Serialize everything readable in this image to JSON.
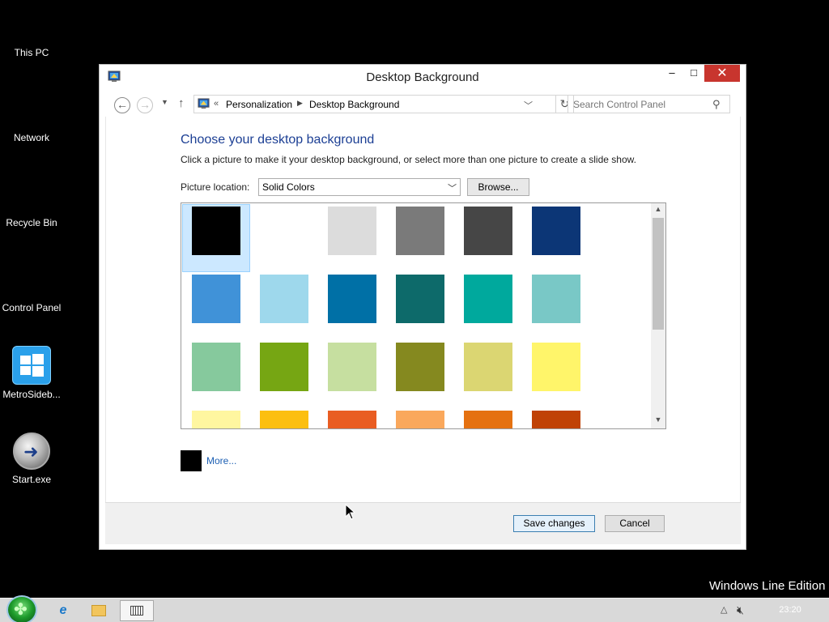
{
  "desktop": {
    "icons": [
      {
        "label": "This PC"
      },
      {
        "label": "Network"
      },
      {
        "label": "Recycle Bin"
      },
      {
        "label": "Control Panel"
      },
      {
        "label": "MetroSideb..."
      },
      {
        "label": "Start.exe"
      }
    ],
    "watermark": "Windows Line Edition"
  },
  "window": {
    "title": "Desktop Background",
    "controls": {
      "minimize": "–",
      "maximize": "□",
      "close": "✕"
    },
    "address": {
      "chevron": "«",
      "crumbs": [
        "Personalization",
        "Desktop Background"
      ],
      "separator": "▶"
    },
    "search": {
      "placeholder": "Search Control Panel"
    },
    "heading": "Choose your desktop background",
    "description": "Click a picture to make it your desktop background, or select more than one picture to create a slide show.",
    "picture_location": {
      "label": "Picture location:",
      "value": "Solid Colors",
      "browse_label": "Browse..."
    },
    "swatches": [
      [
        "#000000",
        "#ffffff",
        "#dcdcdc",
        "#7a7a7a",
        "#464646",
        "#0c3676"
      ],
      [
        "#4092d8",
        "#9ed8ec",
        "#0070a6",
        "#0d6a6a",
        "#00a99d",
        "#79c8c6"
      ],
      [
        "#86c99d",
        "#76a613",
        "#c6dfa0",
        "#85891f",
        "#dbd672",
        "#fff56a"
      ],
      [
        "#fff6a0",
        "#fcbf10",
        "#e95d22",
        "#faa85c",
        "#e57110",
        "#c04206"
      ]
    ],
    "selected_swatch": "#000000",
    "more": {
      "label": "More...",
      "current_color": "#000000"
    },
    "buttons": {
      "save": "Save changes",
      "cancel": "Cancel"
    }
  },
  "taskbar": {
    "items": [
      {
        "icon": "internet-explorer-icon"
      },
      {
        "icon": "file-explorer-icon"
      },
      {
        "icon": "keyboard-icon",
        "active": true
      }
    ],
    "clock": "23:20",
    "accent": "#d9d9d9"
  }
}
